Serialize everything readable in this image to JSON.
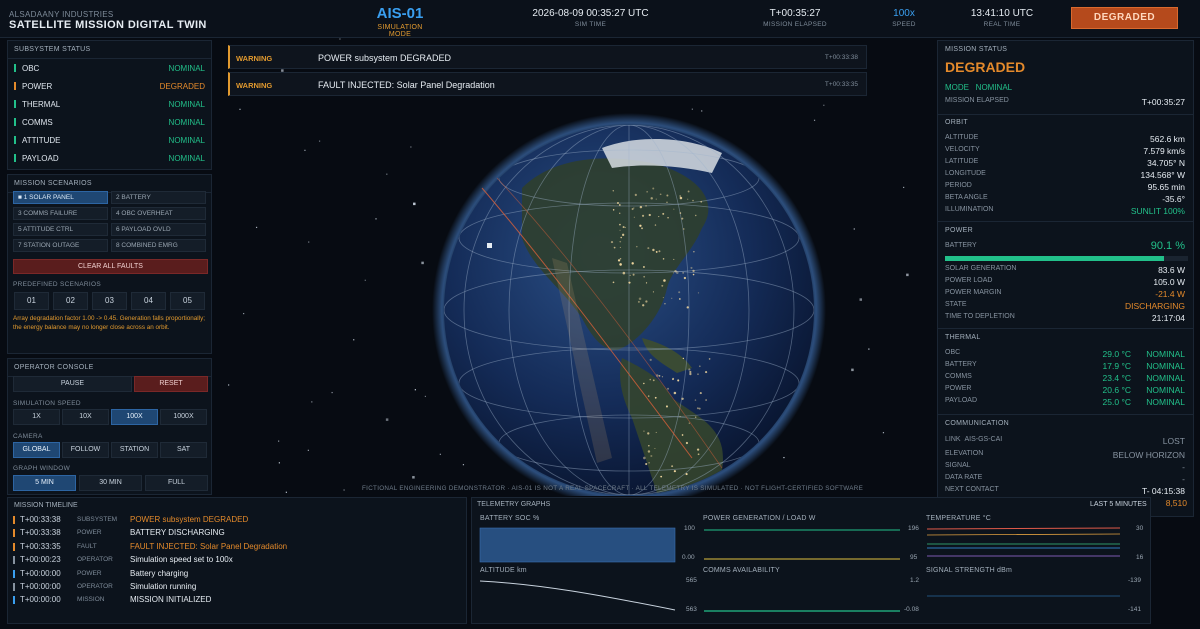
{
  "header": {
    "brand_sub": "ALSADAANY INDUSTRIES",
    "brand_title": "SATELLITE MISSION DIGITAL TWIN",
    "mission_id": "AIS-01",
    "mode_label": "SIMULATION MODE",
    "sim_time": "2026-08-09 00:35:27 UTC",
    "sim_time_label": "SIM TIME",
    "mission_elapsed": "T+00:35:27",
    "mission_elapsed_label": "MISSION ELAPSED",
    "speed": "100x",
    "speed_label": "SPEED",
    "real_time": "13:41:10 UTC",
    "real_time_label": "REAL TIME",
    "status_badge": "DEGRADED"
  },
  "subsystem_status": {
    "title": "SUBSYSTEM STATUS",
    "items": [
      {
        "name": "OBC",
        "status": "NOMINAL",
        "level": "ok"
      },
      {
        "name": "POWER",
        "status": "DEGRADED",
        "level": "warn"
      },
      {
        "name": "THERMAL",
        "status": "NOMINAL",
        "level": "ok"
      },
      {
        "name": "COMMS",
        "status": "NOMINAL",
        "level": "ok"
      },
      {
        "name": "ATTITUDE",
        "status": "NOMINAL",
        "level": "ok"
      },
      {
        "name": "PAYLOAD",
        "status": "NOMINAL",
        "level": "ok"
      }
    ]
  },
  "scenarios": {
    "title": "MISSION SCENARIOS",
    "buttons": [
      {
        "label": "■ 1 SOLAR PANEL",
        "active": true
      },
      {
        "label": "2 BATTERY",
        "active": false
      },
      {
        "label": "3 COMMS FAILURE",
        "active": false
      },
      {
        "label": "4 OBC OVERHEAT",
        "active": false
      },
      {
        "label": "5 ATTITUDE CTRL",
        "active": false
      },
      {
        "label": "6 PAYLOAD OVLD",
        "active": false
      },
      {
        "label": "7 STATION OUTAGE",
        "active": false
      },
      {
        "label": "8 COMBINED EMRG",
        "active": false
      }
    ],
    "clear_label": "CLEAR ALL FAULTS",
    "predefined_label": "PREDEFINED SCENARIOS",
    "predefined": [
      "01",
      "02",
      "03",
      "04",
      "05"
    ],
    "note": "Array degradation factor 1.00 -> 0.45. Generation falls proportionally; the energy balance may no longer close across an orbit."
  },
  "operator_console": {
    "title": "OPERATOR CONSOLE",
    "pause_label": "PAUSE",
    "reset_label": "RESET",
    "speed_label": "SIMULATION SPEED",
    "speeds": [
      {
        "label": "1X",
        "active": false
      },
      {
        "label": "10X",
        "active": false
      },
      {
        "label": "100X",
        "active": true
      },
      {
        "label": "1000X",
        "active": false
      }
    ],
    "camera_label": "CAMERA",
    "cameras": [
      {
        "label": "GLOBAL",
        "active": true
      },
      {
        "label": "FOLLOW",
        "active": false
      },
      {
        "label": "STATION",
        "active": false
      },
      {
        "label": "SAT",
        "active": false
      }
    ],
    "graph_window_label": "GRAPH WINDOW",
    "windows": [
      {
        "label": "5 MIN",
        "active": true
      },
      {
        "label": "30 MIN",
        "active": false
      },
      {
        "label": "FULL",
        "active": false
      }
    ]
  },
  "warnings": [
    {
      "tag": "WARNING",
      "message": "POWER subsystem DEGRADED",
      "time": "T+00:33:38"
    },
    {
      "tag": "WARNING",
      "message": "FAULT INJECTED: Solar Panel Degradation",
      "time": "T+00:33:35"
    }
  ],
  "disclaimer": "FICTIONAL ENGINEERING DEMONSTRATOR · AIS-01 IS NOT A REAL SPACECRAFT · ALL TELEMETRY IS SIMULATED · NOT FLIGHT-CERTIFIED SOFTWARE",
  "mission_status": {
    "title": "MISSION STATUS",
    "state": "DEGRADED",
    "mode_label": "MODE",
    "mode_value": "NOMINAL",
    "elapsed_label": "MISSION ELAPSED",
    "elapsed_value": "T+00:35:27"
  },
  "orbit": {
    "title": "ORBIT",
    "rows": [
      {
        "k": "ALTITUDE",
        "v": "562.6 km"
      },
      {
        "k": "VELOCITY",
        "v": "7.579 km/s"
      },
      {
        "k": "LATITUDE",
        "v": "34.705° N"
      },
      {
        "k": "LONGITUDE",
        "v": "134.568° W"
      },
      {
        "k": "PERIOD",
        "v": "95.65 min"
      },
      {
        "k": "BETA ANGLE",
        "v": "-35.6°"
      },
      {
        "k": "ILLUMINATION",
        "v": "SUNLIT  100%"
      }
    ]
  },
  "power": {
    "title": "POWER",
    "battery_label": "BATTERY",
    "battery_value": "90.1 %",
    "battery_fraction": 0.901,
    "rows": [
      {
        "k": "SOLAR GENERATION",
        "v": "83.6 W"
      },
      {
        "k": "POWER LOAD",
        "v": "105.0 W"
      },
      {
        "k": "POWER MARGIN",
        "v": "-21.4 W"
      },
      {
        "k": "STATE",
        "v": "DISCHARGING"
      },
      {
        "k": "TIME TO DEPLETION",
        "v": "21:17:04"
      }
    ]
  },
  "thermal": {
    "title": "THERMAL",
    "rows": [
      {
        "k": "OBC",
        "t": "29.0 °C",
        "s": "NOMINAL"
      },
      {
        "k": "BATTERY",
        "t": "17.9 °C",
        "s": "NOMINAL"
      },
      {
        "k": "COMMS",
        "t": "23.4 °C",
        "s": "NOMINAL"
      },
      {
        "k": "POWER",
        "t": "20.6 °C",
        "s": "NOMINAL"
      },
      {
        "k": "PAYLOAD",
        "t": "25.0 °C",
        "s": "NOMINAL"
      }
    ]
  },
  "communication": {
    "title": "COMMUNICATION",
    "link_label": "LINK",
    "link_id": "AIS-GS-CAI",
    "link_value": "LOST",
    "rows": [
      {
        "k": "ELEVATION",
        "v": "BELOW HORIZON"
      },
      {
        "k": "SIGNAL",
        "v": "-"
      },
      {
        "k": "DATA RATE",
        "v": "-"
      },
      {
        "k": "NEXT CONTACT",
        "v": "T- 04:15:38"
      }
    ],
    "extra_value": "8,510"
  },
  "timeline": {
    "title": "MISSION TIMELINE",
    "rows": [
      {
        "t": "T+00:33:38",
        "c": "SUBSYSTEM",
        "m": "POWER subsystem DEGRADED",
        "level": "warn"
      },
      {
        "t": "T+00:33:38",
        "c": "POWER",
        "m": "BATTERY DISCHARGING",
        "level": "warn"
      },
      {
        "t": "T+00:33:35",
        "c": "FAULT",
        "m": "FAULT INJECTED: Solar Panel Degradation",
        "level": "warn"
      },
      {
        "t": "T+00:00:23",
        "c": "OPERATOR",
        "m": "Simulation speed set to 100x",
        "level": "grey"
      },
      {
        "t": "T+00:00:00",
        "c": "POWER",
        "m": "Battery charging",
        "level": "info"
      },
      {
        "t": "T+00:00:00",
        "c": "OPERATOR",
        "m": "Simulation running",
        "level": "grey"
      },
      {
        "t": "T+00:00:00",
        "c": "MISSION",
        "m": "MISSION INITIALIZED",
        "level": "info"
      }
    ]
  },
  "telemetry": {
    "title": "TELEMETRY GRAPHS",
    "window_label": "LAST 5 MINUTES",
    "graphs": {
      "battery": {
        "title": "BATTERY SOC  %",
        "top": "100",
        "bottom": "0.00"
      },
      "power": {
        "title": "POWER  GENERATION / LOAD  W",
        "top": "196",
        "bottom": "95"
      },
      "temperature": {
        "title": "TEMPERATURE  °C",
        "top": "30",
        "bottom": "16"
      },
      "altitude": {
        "title": "ALTITUDE  km",
        "top": "565",
        "bottom": "563"
      },
      "comms": {
        "title": "COMMS AVAILABILITY",
        "top": "1.2",
        "bottom": "-0.08"
      },
      "signal": {
        "title": "SIGNAL STRENGTH  dBm",
        "top": "-139",
        "bottom": "-141"
      }
    }
  }
}
